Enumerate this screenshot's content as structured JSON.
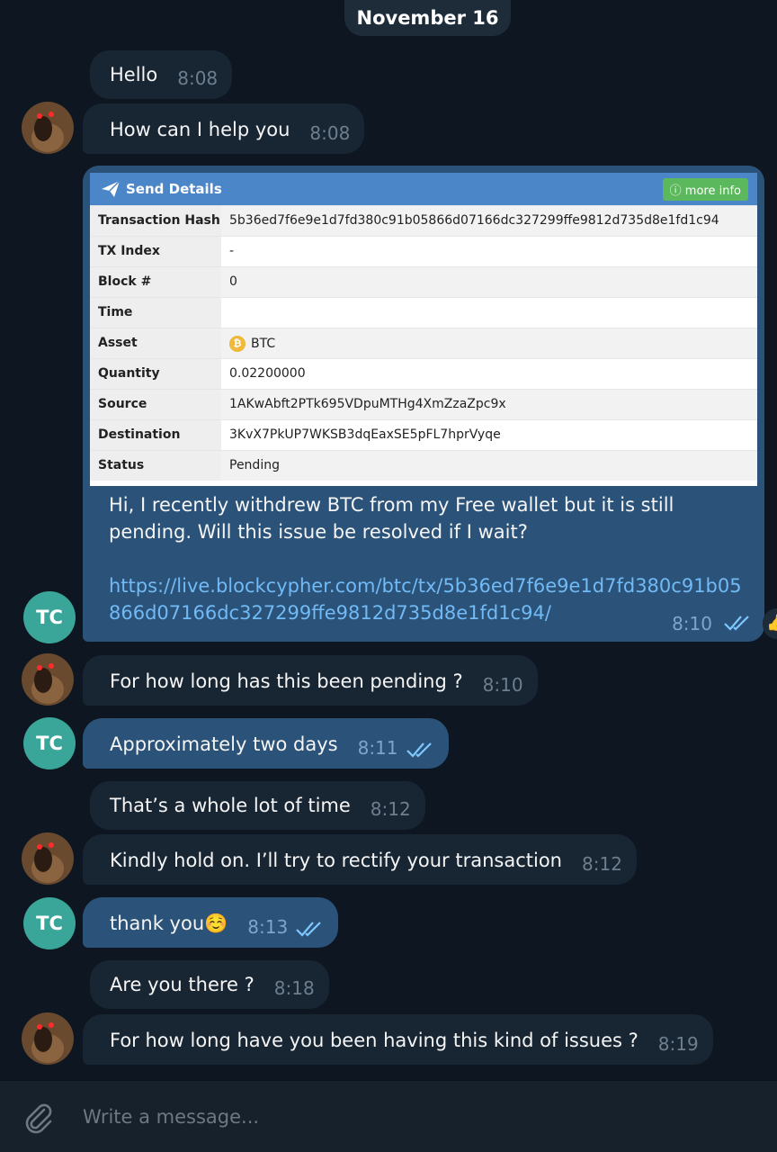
{
  "date_label": "November 16",
  "avatar_tc": "TC",
  "messages": [
    {
      "text": "Hello",
      "time": "8:08"
    },
    {
      "text": "How can I help you",
      "time": "8:08"
    },
    {
      "text": "For how long has this been pending ?",
      "time": "8:10"
    },
    {
      "text": "Approximately two days",
      "time": "8:11"
    },
    {
      "text": "That’s a whole lot of time",
      "time": "8:12"
    },
    {
      "text": "Kindly hold on. I’ll try to rectify your transaction",
      "time": "8:12"
    },
    {
      "text": "thank you☺️",
      "time": "8:13"
    },
    {
      "text": "Are you there ?",
      "time": "8:18"
    },
    {
      "text": "For how long have you been having this kind of issues ?",
      "time": "8:19"
    }
  ],
  "screenshot_message": {
    "card_title": "Send Details",
    "more_info": "more info",
    "rows": [
      {
        "label": "Transaction Hash",
        "value": "5b36ed7f6e9e1d7fd380c91b05866d07166dc327299ffe9812d735d8e1fd1c94"
      },
      {
        "label": "TX Index",
        "value": "-"
      },
      {
        "label": "Block #",
        "value": "0"
      },
      {
        "label": "Time",
        "value": ""
      },
      {
        "label": "Asset",
        "value": "BTC"
      },
      {
        "label": "Quantity",
        "value": "0.02200000"
      },
      {
        "label": "Source",
        "value": "1AKwAbft2PTk695VDpuMTHg4XmZzaZpc9x"
      },
      {
        "label": "Destination",
        "value": "3KvX7PkUP7WKSB3dqEaxSE5pFL7hprVyqe"
      },
      {
        "label": "Status",
        "value": "Pending"
      }
    ],
    "text": "Hi, I recently withdrew BTC from my Free wallet but it is still pending. Will this issue be resolved if I wait?",
    "link": "https://live.blockcypher.com/btc/tx/5b36ed7f6e9e1d7fd380c91b05866d07166dc327299ffe9812d735d8e1fd1c94/",
    "time": "8:10"
  },
  "composer": {
    "placeholder": "Write a message..."
  },
  "colors": {
    "background": "#0e1621",
    "incoming": "#182533",
    "outgoing": "#2b5278",
    "accent": "#71baf5"
  }
}
